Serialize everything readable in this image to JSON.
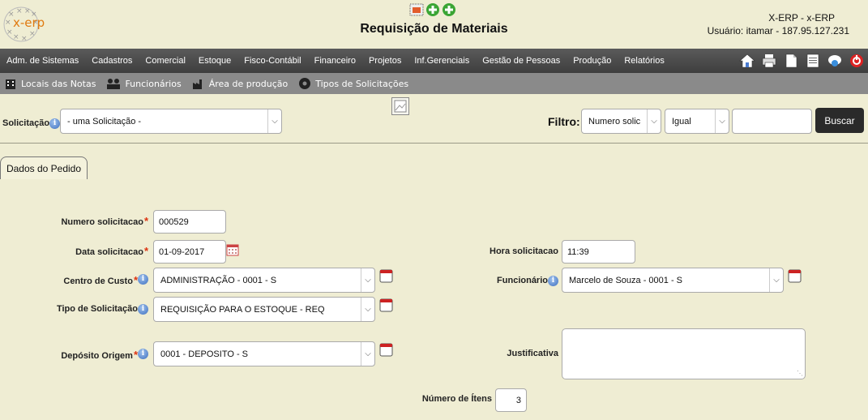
{
  "header": {
    "logo_text": "x-erp",
    "title": "Requisição de Materiais",
    "app_name": "X-ERP - x-ERP",
    "user_line": "Usuário: itamar - 187.95.127.231"
  },
  "menu": {
    "items": [
      "Adm. de Sistemas",
      "Cadastros",
      "Comercial",
      "Estoque",
      "Fisco-Contábil",
      "Financeiro",
      "Projetos",
      "Inf.Gerenciais",
      "Gestão de Pessoas",
      "Produção",
      "Relatórios"
    ],
    "icons": [
      "home-icon",
      "print-icon",
      "document-icon",
      "report-icon",
      "chat-icon",
      "logout-icon"
    ]
  },
  "submenu": {
    "items": [
      {
        "label": "Locais das Notas",
        "icon": "building-icon"
      },
      {
        "label": "Funcionários",
        "icon": "people-icon"
      },
      {
        "label": "Área de produção",
        "icon": "factory-icon"
      },
      {
        "label": "Tipos de Solicitações",
        "icon": "gear-icon"
      }
    ]
  },
  "filterbar": {
    "solicitacao_label": "Solicitação",
    "solicitacao_value": "- uma Solicitação -",
    "filtro_label": "Filtro:",
    "filtro_field": "Numero solic",
    "filtro_operator": "Igual",
    "filtro_value": "",
    "buscar_label": "Buscar"
  },
  "tab": {
    "label": "Dados do Pedido"
  },
  "form": {
    "numero_label": "Numero solicitacao",
    "numero_value": "000529",
    "data_label": "Data solicitacao",
    "data_value": "01-09-2017",
    "hora_label": "Hora solicitacao",
    "hora_value": "11:39",
    "centro_label": "Centro de Custo",
    "centro_value": "ADMINISTRAÇÃO - 0001 - S",
    "funcionario_label": "Funcionário",
    "funcionario_value": "Marcelo de Souza - 0001 - S",
    "tipo_label": "Tipo de Solicitação",
    "tipo_value": "REQUISIÇÃO PARA O ESTOQUE - REQ",
    "deposito_label": "Depósito Origem",
    "deposito_value": "0001 - DEPOSITO - S",
    "justificativa_label": "Justificativa",
    "justificativa_value": "",
    "itens_label": "Número de Ítens",
    "itens_value": "3"
  },
  "colors": {
    "background": "#efedd3",
    "menubar": "#4a4a4a",
    "submenu": "#8a8a8a",
    "button": "#2a2a2a",
    "required": "#d31111"
  }
}
